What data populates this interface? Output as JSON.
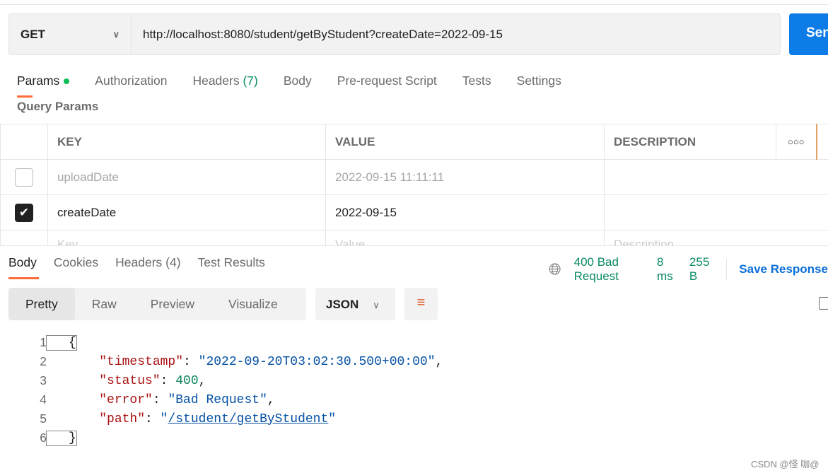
{
  "request": {
    "method": "GET",
    "url": "http://localhost:8080/student/getByStudent?createDate=2022-09-15",
    "send_label": "Send"
  },
  "req_tabs": {
    "params": "Params",
    "authorization": "Authorization",
    "headers": "Headers",
    "headers_count": "(7)",
    "body": "Body",
    "prerequest": "Pre-request Script",
    "tests": "Tests",
    "settings": "Settings"
  },
  "query_params": {
    "title": "Query Params",
    "headers": [
      "KEY",
      "VALUE",
      "DESCRIPTION"
    ],
    "rows": [
      {
        "key": "uploadDate",
        "value": "2022-09-15 11:11:11",
        "checked": false
      },
      {
        "key": "createDate",
        "value": "2022-09-15",
        "checked": true
      }
    ],
    "placeholders": {
      "key": "Key",
      "value": "Value",
      "description": "Description"
    }
  },
  "resp_tabs": {
    "body": "Body",
    "cookies": "Cookies",
    "headers": "Headers (4)",
    "test_results": "Test Results"
  },
  "status": {
    "code": "400 Bad Request",
    "time": "8 ms",
    "size": "255 B",
    "save": "Save Response"
  },
  "view": {
    "pretty": "Pretty",
    "raw": "Raw",
    "preview": "Preview",
    "visualize": "Visualize",
    "format": "JSON"
  },
  "body": {
    "lines": [
      "1",
      "2",
      "3",
      "4",
      "5",
      "6"
    ],
    "open": "{",
    "close": "}",
    "timestamp_key": "\"timestamp\"",
    "timestamp_val": "\"2022-09-20T03:02:30.500+00:00\"",
    "status_key": "\"status\"",
    "status_val": "400",
    "error_key": "\"error\"",
    "error_val": "\"Bad Request\"",
    "path_key": "\"path\"",
    "path_val": "/student/getByStudent"
  },
  "watermark": "CSDN @怪 咖@",
  "colors": {
    "accent": "#ff6c37",
    "send": "#0d7ce6",
    "status_ok": "#0a8a66"
  }
}
